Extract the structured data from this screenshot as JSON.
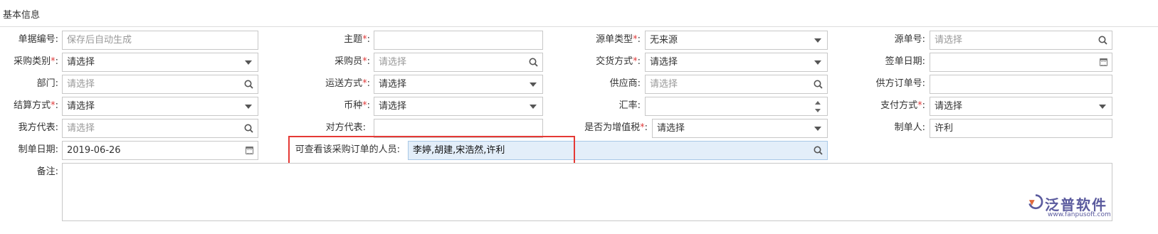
{
  "section": {
    "title": "基本信息"
  },
  "fields": {
    "doc_no": {
      "label": "单据编号:",
      "value": "保存后自动生成"
    },
    "subject": {
      "label": "主题",
      "value": ""
    },
    "source_type": {
      "label": "源单类型",
      "value": "无来源"
    },
    "source_no": {
      "label": "源单号:",
      "placeholder": "请选择"
    },
    "purchase_cat": {
      "label": "采购类别",
      "value": "请选择"
    },
    "buyer": {
      "label": "采购员",
      "placeholder": "请选择"
    },
    "delivery": {
      "label": "交货方式",
      "value": "请选择"
    },
    "sign_date": {
      "label": "签单日期:",
      "value": ""
    },
    "dept": {
      "label": "部门:",
      "placeholder": "请选择"
    },
    "shipping": {
      "label": "运送方式",
      "value": "请选择"
    },
    "supplier": {
      "label": "供应商:",
      "placeholder": "请选择"
    },
    "supplier_order": {
      "label": "供方订单号:",
      "value": ""
    },
    "settlement": {
      "label": "结算方式",
      "value": "请选择"
    },
    "currency": {
      "label": "币种",
      "value": "请选择"
    },
    "rate": {
      "label": "汇率:",
      "value": ""
    },
    "payment": {
      "label": "支付方式",
      "value": "请选择"
    },
    "our_rep": {
      "label": "我方代表:",
      "placeholder": "请选择"
    },
    "their_rep": {
      "label": "对方代表:",
      "value": ""
    },
    "vat": {
      "label": "是否为增值税",
      "value": "请选择"
    },
    "creator": {
      "label": "制单人:",
      "value": "许利"
    },
    "create_date": {
      "label": "制单日期:",
      "value": "2019-06-26"
    },
    "viewers": {
      "label": "可查看该采购订单的人员:",
      "value": "李婷,胡建,宋浩然,许利"
    },
    "remark": {
      "label": "备注:",
      "value": ""
    }
  },
  "required_marker": "*",
  "required_suffix": ":",
  "logo": {
    "text": "泛普软件",
    "url": "www.fanpusoft.com"
  }
}
